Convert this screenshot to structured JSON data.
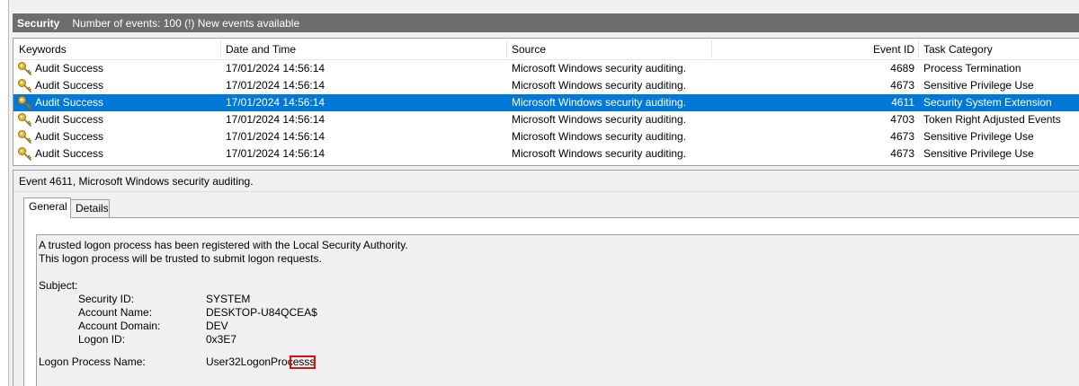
{
  "titlebar": {
    "log_name": "Security",
    "status": "Number of events: 100 (!) New events available"
  },
  "list": {
    "columns": [
      "Keywords",
      "Date and Time",
      "Source",
      "Event ID",
      "Task Category"
    ],
    "rows": [
      {
        "keyword": "Audit Success",
        "datetime": "17/01/2024 14:56:14",
        "source": "Microsoft Windows security auditing.",
        "event_id": "4689",
        "task_category": "Process Termination",
        "icon": "key-icon"
      },
      {
        "keyword": "Audit Success",
        "datetime": "17/01/2024 14:56:14",
        "source": "Microsoft Windows security auditing.",
        "event_id": "4673",
        "task_category": "Sensitive Privilege Use",
        "icon": "key-icon"
      },
      {
        "keyword": "Audit Success",
        "datetime": "17/01/2024 14:56:14",
        "source": "Microsoft Windows security auditing.",
        "event_id": "4611",
        "task_category": "Security System Extension",
        "icon": "key-icon",
        "selected": true
      },
      {
        "keyword": "Audit Success",
        "datetime": "17/01/2024 14:56:14",
        "source": "Microsoft Windows security auditing.",
        "event_id": "4703",
        "task_category": "Token Right Adjusted Events",
        "icon": "key-icon"
      },
      {
        "keyword": "Audit Success",
        "datetime": "17/01/2024 14:56:14",
        "source": "Microsoft Windows security auditing.",
        "event_id": "4673",
        "task_category": "Sensitive Privilege Use",
        "icon": "key-icon"
      },
      {
        "keyword": "Audit Success",
        "datetime": "17/01/2024 14:56:14",
        "source": "Microsoft Windows security auditing.",
        "event_id": "4673",
        "task_category": "Sensitive Privilege Use",
        "icon": "key-icon"
      }
    ]
  },
  "detail": {
    "title": "Event 4611, Microsoft Windows security auditing.",
    "tabs": [
      "General",
      "Details"
    ],
    "active_tab": "General",
    "description_line1": "A trusted logon process has been registered with the Local Security Authority.",
    "description_line2": "This logon process will be trusted to submit logon requests.",
    "subject_heading": "Subject:",
    "fields": [
      {
        "label": "Security ID:",
        "value": "SYSTEM"
      },
      {
        "label": "Account Name:",
        "value": "DESKTOP-U84QCEA$"
      },
      {
        "label": "Account Domain:",
        "value": "DEV"
      },
      {
        "label": "Logon ID:",
        "value": "0x3E7"
      }
    ],
    "logon_process_label": "Logon Process Name:",
    "logon_process_value": "User32LogonProcesss"
  },
  "colors": {
    "selection": "#0078d7",
    "titlebar": "#6d6d6d",
    "highlight_box": "#e01010"
  }
}
